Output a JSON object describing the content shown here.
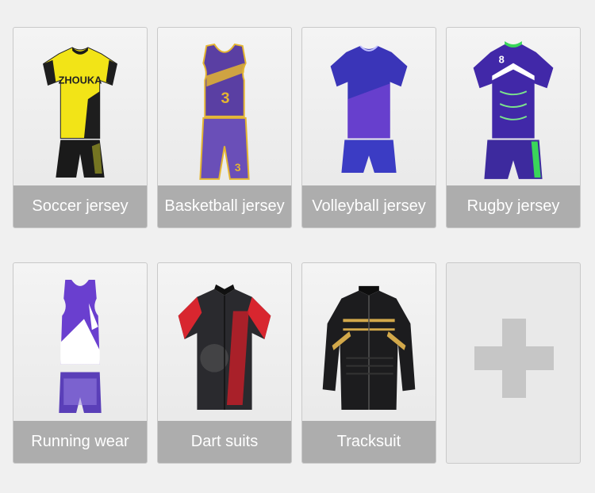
{
  "products": [
    {
      "id": "soccer",
      "label": "Soccer jersey",
      "icon": "soccer-jersey-icon"
    },
    {
      "id": "basketball",
      "label": "Basketball jersey",
      "icon": "basketball-jersey-icon"
    },
    {
      "id": "volleyball",
      "label": "Volleyball jersey",
      "icon": "volleyball-jersey-icon"
    },
    {
      "id": "rugby",
      "label": "Rugby jersey",
      "icon": "rugby-jersey-icon"
    },
    {
      "id": "running",
      "label": "Running wear",
      "icon": "running-wear-icon"
    },
    {
      "id": "dart",
      "label": "Dart suits",
      "icon": "dart-suit-icon"
    },
    {
      "id": "tracksuit",
      "label": "Tracksuit",
      "icon": "tracksuit-icon"
    }
  ],
  "jersey_text": {
    "soccer_brand": "ZHOUKA",
    "basketball_number": "3",
    "rugby_number": "8"
  },
  "add_card": {
    "icon": "plus-icon"
  },
  "colors": {
    "caption_bg": "#adadad",
    "caption_text": "#ffffff",
    "page_bg": "#f0f0f0"
  }
}
